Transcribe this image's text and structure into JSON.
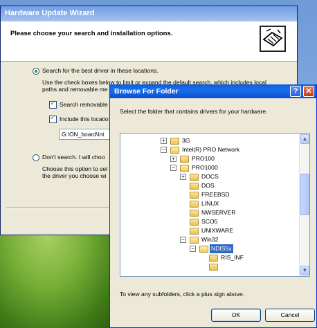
{
  "wizard": {
    "title": "Hardware Update Wizard",
    "heading": "Please choose your search and installation options.",
    "option_search": "Search for the best driver in these locations.",
    "search_desc_1": "Use the check boxes below to limit or expand the default search, which includes local",
    "search_desc_2": "paths and removable me",
    "cb_removable": "Search removable",
    "cb_include": "Include this locatio",
    "path_value": "G:\\ON_board\\Int",
    "option_dont": "Don't search. I will choo",
    "dont_desc_1": "Choose this option to sel",
    "dont_desc_2": "the driver you choose wi"
  },
  "browse": {
    "title": "Browse For Folder",
    "help_label": "?",
    "close_label": "✕",
    "description": "Select the folder that contains drivers for your hardware.",
    "tree": [
      {
        "label": "3G",
        "toggle": "+"
      },
      {
        "label": "Intel(R) PRO Network",
        "toggle": "−"
      },
      {
        "label": "PRO100",
        "toggle": "+"
      },
      {
        "label": "PRO1000",
        "toggle": "−"
      },
      {
        "label": "DOCS",
        "toggle": "+"
      },
      {
        "label": "DOS",
        "toggle": ""
      },
      {
        "label": "FREEBSD",
        "toggle": ""
      },
      {
        "label": "LINUX",
        "toggle": ""
      },
      {
        "label": "NWSERVER",
        "toggle": ""
      },
      {
        "label": "SCO5",
        "toggle": ""
      },
      {
        "label": "UNIXWARE",
        "toggle": ""
      },
      {
        "label": "Win32",
        "toggle": "−"
      },
      {
        "label": "NDIS5x",
        "toggle": "−",
        "selected": true
      },
      {
        "label": "RIS_INF",
        "toggle": ""
      }
    ],
    "hint": "To view any subfolders, click a plus sign above.",
    "ok_label": "OK",
    "cancel_label": "Cancel"
  },
  "colors": {
    "title_bar": "#0a5ee0",
    "selection": "#316ac5",
    "dialog_bg": "#ece9d8"
  }
}
